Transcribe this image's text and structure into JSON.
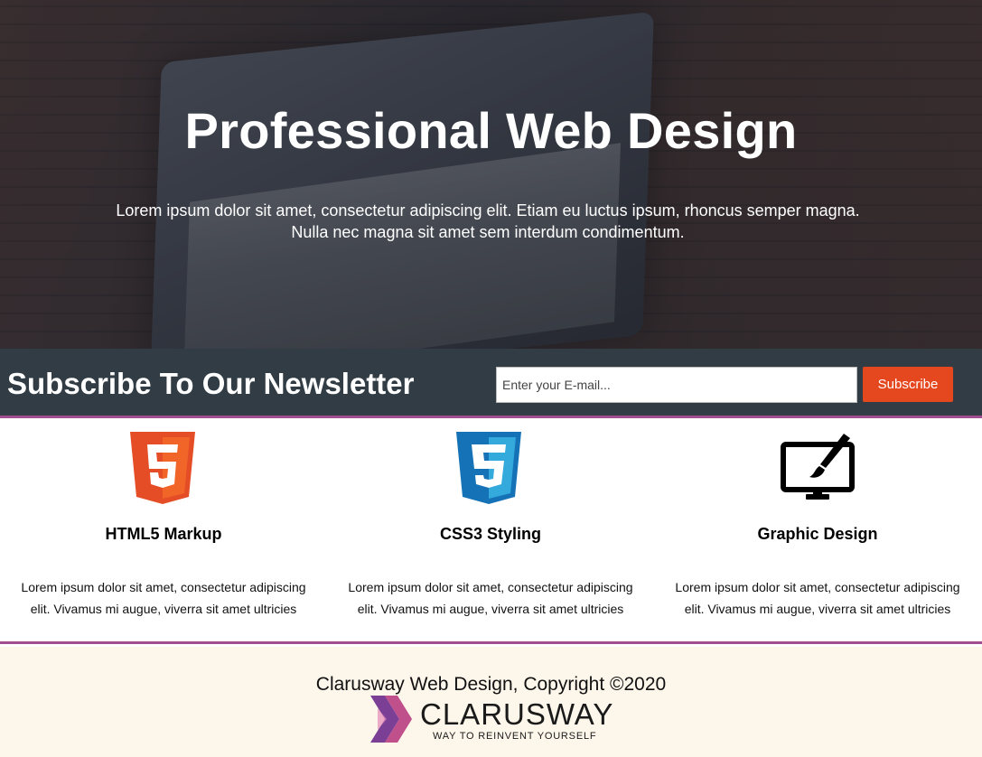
{
  "hero": {
    "title": "Professional Web Design",
    "text_line1": "Lorem ipsum dolor sit amet, consectetur adipiscing elit. Etiam eu luctus ipsum, rhoncus semper magna.",
    "text_line2": "Nulla nec magna sit amet sem interdum condimentum."
  },
  "newsletter": {
    "heading": "Subscribe To Our Newsletter",
    "email_placeholder": "Enter your E-mail...",
    "button_label": "Subscribe"
  },
  "features": [
    {
      "icon": "html5-icon",
      "title": "HTML5 Markup",
      "text": "Lorem ipsum dolor sit amet, consectetur adipiscing elit. Vivamus mi augue, viverra sit amet ultricies"
    },
    {
      "icon": "css3-icon",
      "title": "CSS3 Styling",
      "text": "Lorem ipsum dolor sit amet, consectetur adipiscing elit. Vivamus mi augue, viverra sit amet ultricies"
    },
    {
      "icon": "monitor-brush-icon",
      "title": "Graphic Design",
      "text": "Lorem ipsum dolor sit amet, consectetur adipiscing elit. Vivamus mi augue, viverra sit amet ultricies"
    }
  ],
  "footer": {
    "copyright": "Clarusway Web Design, Copyright ©2020",
    "logo_brand": "CLARUSWAY",
    "logo_tagline": "WAY TO REINVENT YOURSELF"
  },
  "colors": {
    "newsletter_bg": "#313c45",
    "accent_border": "#a04e8f",
    "button_orange": "#e5471f",
    "footer_bg": "#fdf6ea",
    "html5_orange": "#e44d26",
    "css3_blue": "#1572b6"
  }
}
